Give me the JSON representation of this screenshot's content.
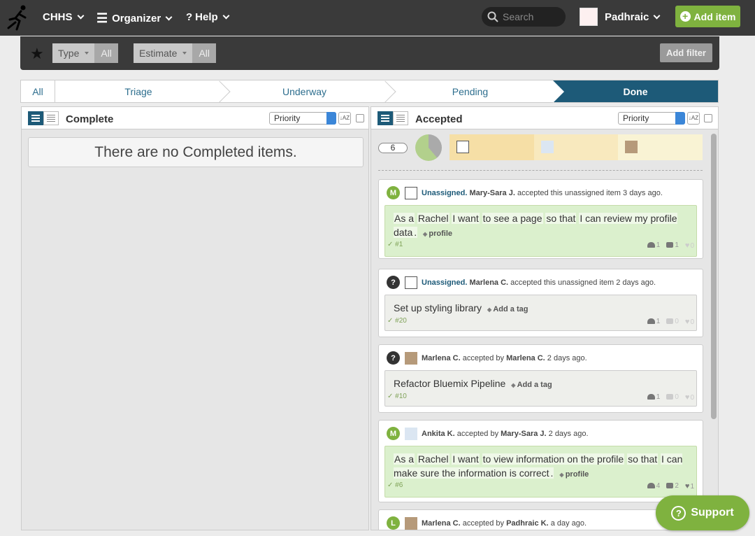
{
  "nav": {
    "project": "CHHS",
    "organizer": "Organizer",
    "help": "Help",
    "search_placeholder": "Search",
    "user": "Padhraic",
    "add_item": "Add item"
  },
  "filters": {
    "type_label": "Type",
    "type_value": "All",
    "estimate_label": "Estimate",
    "estimate_value": "All",
    "add_filter": "Add filter"
  },
  "stages": [
    "All",
    "Triage",
    "Underway",
    "Pending",
    "Done"
  ],
  "columns": {
    "complete": {
      "title": "Complete",
      "sort": "Priority",
      "empty": "There are no Completed items."
    },
    "accepted": {
      "title": "Accepted",
      "sort": "Priority",
      "count": "6"
    }
  },
  "cards": [
    {
      "badge": "M",
      "badge_color": "#7fb23f",
      "who": "Unassigned.",
      "by": "Mary-Sara J.",
      "mid": "accepted this unassigned item",
      "when": "3 days ago.",
      "story": [
        "As a",
        "Rachel",
        "I want",
        "to see a page",
        "so that",
        "I can review my profile data",
        "."
      ],
      "tag": "profile",
      "id": "✓ #1",
      "people": "1",
      "comments": "1",
      "likes": "0"
    },
    {
      "badge": "?",
      "badge_color": "#333333",
      "who": "Unassigned.",
      "by": "Marlena C.",
      "mid": "accepted this unassigned item",
      "when": "2 days ago.",
      "title": "Set up styling library",
      "tag": "Add a tag",
      "id": "✓ #20",
      "people": "1",
      "comments": "0",
      "likes": "0"
    },
    {
      "badge": "?",
      "badge_color": "#333333",
      "who": "Marlena C.",
      "mid": "accepted by",
      "by": "Marlena C.",
      "when": "2 days ago.",
      "title": "Refactor Bluemix Pipeline",
      "tag": "Add a tag",
      "id": "✓ #10",
      "people": "1",
      "comments": "0",
      "likes": "0"
    },
    {
      "badge": "M",
      "badge_color": "#7fb23f",
      "who": "Ankita K.",
      "mid": "accepted by",
      "by": "Mary-Sara J.",
      "when": "2 days ago.",
      "story": [
        "As a",
        "Rachel",
        "I want",
        "to view information on the profile",
        "so that",
        "I can make sure the information is correct",
        "."
      ],
      "tag": "profile",
      "id": "✓ #6",
      "people": "4",
      "comments": "2",
      "likes": "1"
    },
    {
      "badge": "L",
      "badge_color": "#7fb23f",
      "who": "Marlena C.",
      "mid": "accepted by",
      "by": "Padhraic K.",
      "when": "a day ago."
    }
  ],
  "support": "Support",
  "colors": {
    "topbar": "#3a3a3a",
    "accent_green": "#7fb23f",
    "done_blue": "#1d5a78",
    "story_green": "#dbf0cd"
  }
}
